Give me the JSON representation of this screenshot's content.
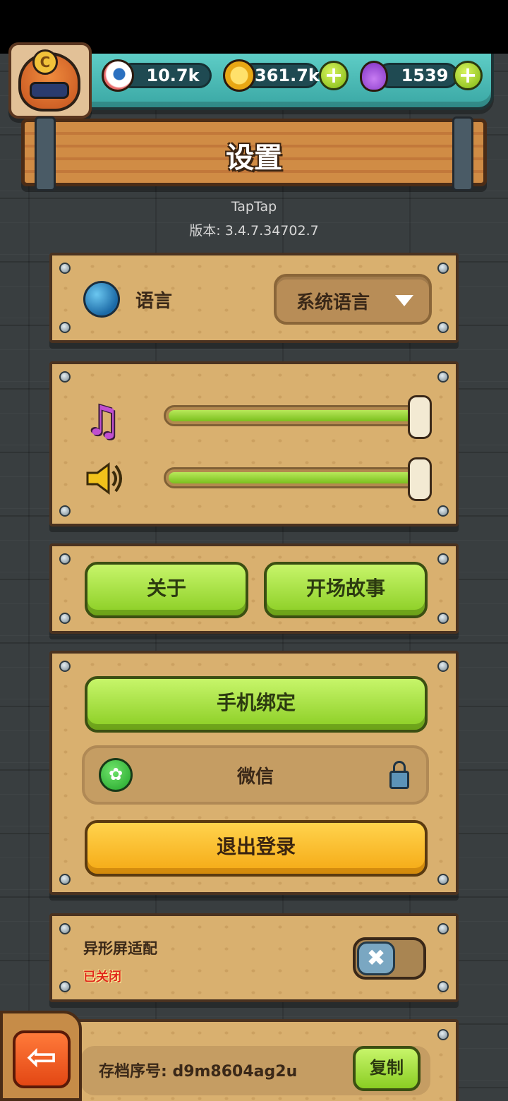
{
  "hud": {
    "eyeballs": "10.7k",
    "coins": "361.7k",
    "potions": "1539",
    "avatar_badge": "C",
    "plus": "+"
  },
  "page": {
    "title": "设置",
    "platform": "TapTap",
    "version": "版本: 3.4.7.34702.7"
  },
  "language": {
    "label": "语言",
    "selected": "系统语言"
  },
  "audio": {
    "music_level": 1.0,
    "sound_level": 1.0
  },
  "buttons": {
    "about": "关于",
    "opening_story": "开场故事",
    "bind_phone": "手机绑定",
    "wechat": "微信",
    "logout": "退出登录",
    "copy": "复制"
  },
  "notch": {
    "label": "异形屏适配",
    "status": "已关闭",
    "enabled": false,
    "toggle_glyph": "✖"
  },
  "archive": {
    "text": "存档序号: d9m8604ag2u"
  },
  "icons": {
    "music": "♫",
    "wechat": "✿",
    "back": "⇦"
  },
  "colors": {
    "accent_green": "#8acd23",
    "accent_yellow": "#f5a914",
    "status_off": "#e0281c"
  }
}
